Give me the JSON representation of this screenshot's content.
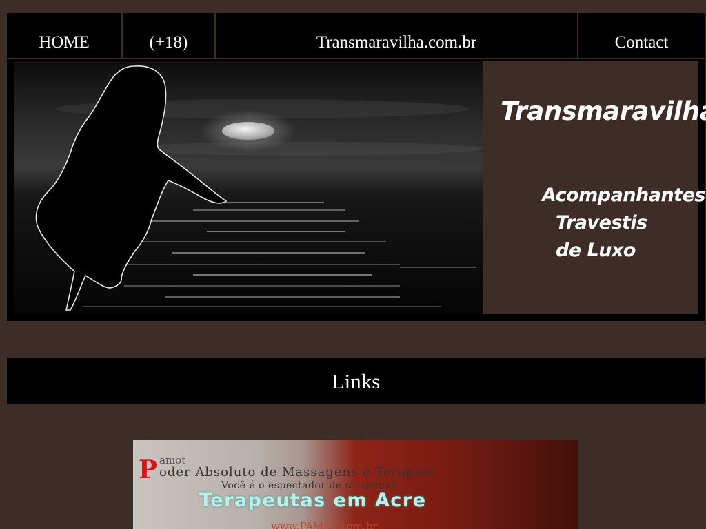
{
  "nav": {
    "items": [
      {
        "label": "HOME"
      },
      {
        "label": "(+18)"
      },
      {
        "label": "Transmaravilha.com.br"
      },
      {
        "label": "Contact"
      }
    ]
  },
  "banner": {
    "brand": "Transmaravilha",
    "tagline": [
      "Acompanhantes",
      "Travestis",
      "de Luxo"
    ]
  },
  "section": {
    "title": "Links"
  },
  "ad": {
    "letter_p": "P",
    "small_text": "amot",
    "title": "oder Absoluto de Massagens e Terapias",
    "subtitle": "Você é o espectador de si mesmo!",
    "headline": "Terapeutas em Acre",
    "url": "www.PAMOT.com.br"
  },
  "colors": {
    "background": "#3e2c26",
    "bars": "#000000",
    "text": "#ffffff"
  }
}
